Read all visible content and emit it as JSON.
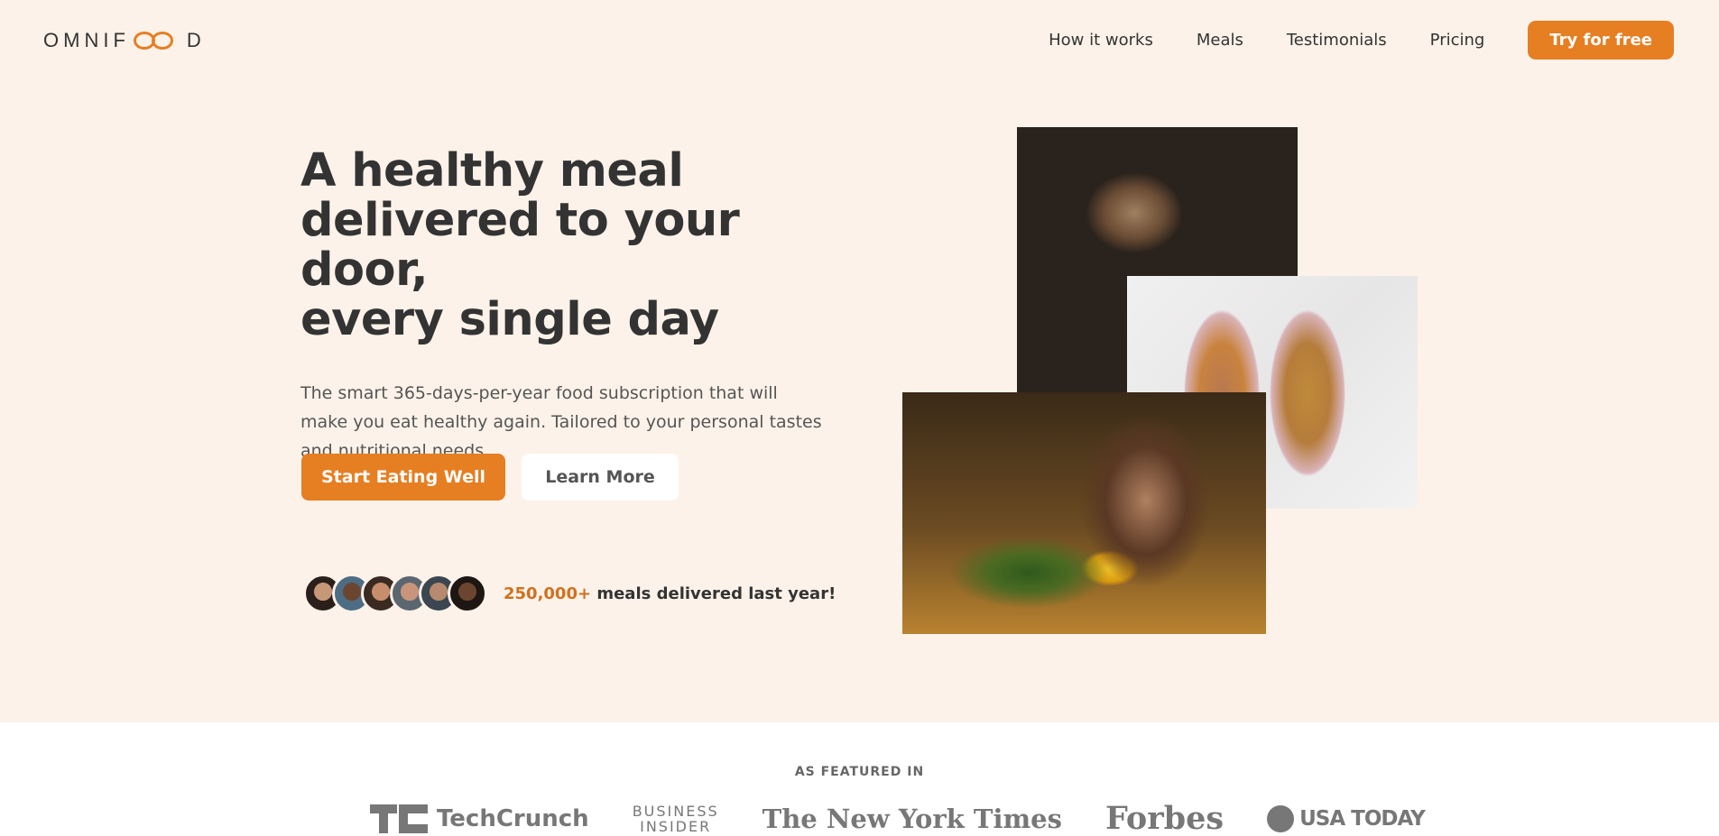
{
  "header": {
    "logo": "OMNIFOOD",
    "nav": [
      {
        "label": "How it works"
      },
      {
        "label": "Meals"
      },
      {
        "label": "Testimonials"
      },
      {
        "label": "Pricing"
      }
    ],
    "cta_label": "Try for free"
  },
  "hero": {
    "title_line1": "A healthy meal",
    "title_line2": "delivered to your door,",
    "title_line3": "every single day",
    "description": "The smart 365-days-per-year food subscription that will make you eat healthy again. Tailored to your personal tastes and nutritional needs.",
    "primary_button": "Start Eating Well",
    "secondary_button": "Learn More",
    "delivered_count": "250,000+",
    "delivered_text": " meals delivered last year!"
  },
  "featured": {
    "label": "AS FEATURED IN",
    "logos": [
      {
        "text": "TechCrunch"
      },
      {
        "text_line1": "BUSINESS",
        "text_line2": "INSIDER"
      },
      {
        "text": "The New York Times"
      },
      {
        "text": "Forbes"
      },
      {
        "text": "USA TODAY"
      }
    ]
  },
  "colors": {
    "accent": "#e67e22",
    "background": "#fdf2e9"
  }
}
